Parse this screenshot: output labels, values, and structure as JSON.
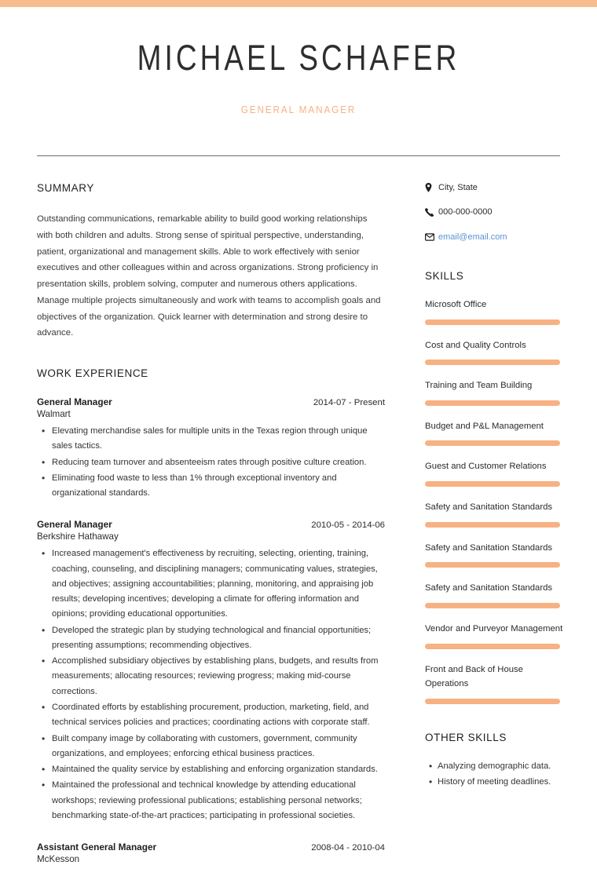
{
  "theme": {
    "accent": "#f7bc8e",
    "accent_bar": "#f7b183",
    "subtitle_color": "#f7b183",
    "link_color": "#5b93d6",
    "text_color": "#2b2b2b",
    "divider_color": "#6b6b6b"
  },
  "header": {
    "name": "MICHAEL SCHAFER",
    "subtitle": "GENERAL MANAGER"
  },
  "summary": {
    "heading": "SUMMARY",
    "text": "Outstanding communications, remarkable ability to build good working relationships with both children and adults. Strong sense of spiritual perspective, understanding, patient, organizational and management skills. Able to work effectively with senior executives and other colleagues within and across organizations. Strong proficiency in presentation skills, problem solving, computer and numerous others applications. Manage multiple projects simultaneously and work with teams to accomplish goals and objectives of the organization. Quick learner with determination and strong desire to advance."
  },
  "work_experience": {
    "heading": "WORK EXPERIENCE",
    "jobs": [
      {
        "title": "General Manager",
        "dates": "2014-07 - Present",
        "company": "Walmart",
        "bullets": [
          "Elevating merchandise sales for multiple units in the Texas region through unique sales tactics.",
          "Reducing team turnover and absenteeism rates through positive culture creation.",
          "Eliminating food waste to less than 1% through exceptional inventory and organizational standards."
        ]
      },
      {
        "title": "General Manager",
        "dates": "2010-05 - 2014-06",
        "company": "Berkshire Hathaway",
        "bullets": [
          "Increased management's effectiveness by recruiting, selecting, orienting, training, coaching, counseling, and disciplining managers; communicating values, strategies, and objectives; assigning accountabilities; planning, monitoring, and appraising job results; developing incentives; developing a climate for offering information and opinions; providing educational opportunities.",
          "Developed the strategic plan by studying technological and financial opportunities; presenting assumptions; recommending objectives.",
          "Accomplished subsidiary objectives by establishing plans, budgets, and results from measurements; allocating resources; reviewing progress; making mid-course corrections.",
          "Coordinated efforts by establishing procurement, production, marketing, field, and technical services policies and practices; coordinating actions with corporate staff.",
          "Built company image by collaborating with customers, government, community organizations, and employees; enforcing ethical business practices.",
          "Maintained the quality service by establishing and enforcing organization standards.",
          "Maintained the professional and technical knowledge by attending educational workshops; reviewing professional publications; establishing personal networks; benchmarking state-of-the-art practices; participating in professional societies."
        ]
      },
      {
        "title": "Assistant General Manager",
        "dates": "2008-04 - 2010-04",
        "company": "McKesson",
        "bullets": []
      }
    ]
  },
  "contact": {
    "items": [
      {
        "icon": "location-pin-icon",
        "text": "City, State",
        "is_link": false
      },
      {
        "icon": "phone-icon",
        "text": "000-000-0000",
        "is_link": false
      },
      {
        "icon": "envelope-icon",
        "text": "email@email.com",
        "is_link": true
      }
    ]
  },
  "skills": {
    "heading": "SKILLS",
    "items": [
      {
        "label": "Microsoft Office"
      },
      {
        "label": "Cost and Quality Controls"
      },
      {
        "label": "Training and Team Building"
      },
      {
        "label": "Budget and P&L Management"
      },
      {
        "label": "Guest and Customer Relations"
      },
      {
        "label": "Safety and Sanitation Standards"
      },
      {
        "label": "Safety and Sanitation Standards"
      },
      {
        "label": "Safety and Sanitation Standards"
      },
      {
        "label": "Vendor and Purveyor Management"
      },
      {
        "label": "Front and Back of House Operations"
      }
    ]
  },
  "other_skills": {
    "heading": "OTHER SKILLS",
    "items": [
      "Analyzing demographic data.",
      "History of meeting deadlines."
    ]
  }
}
